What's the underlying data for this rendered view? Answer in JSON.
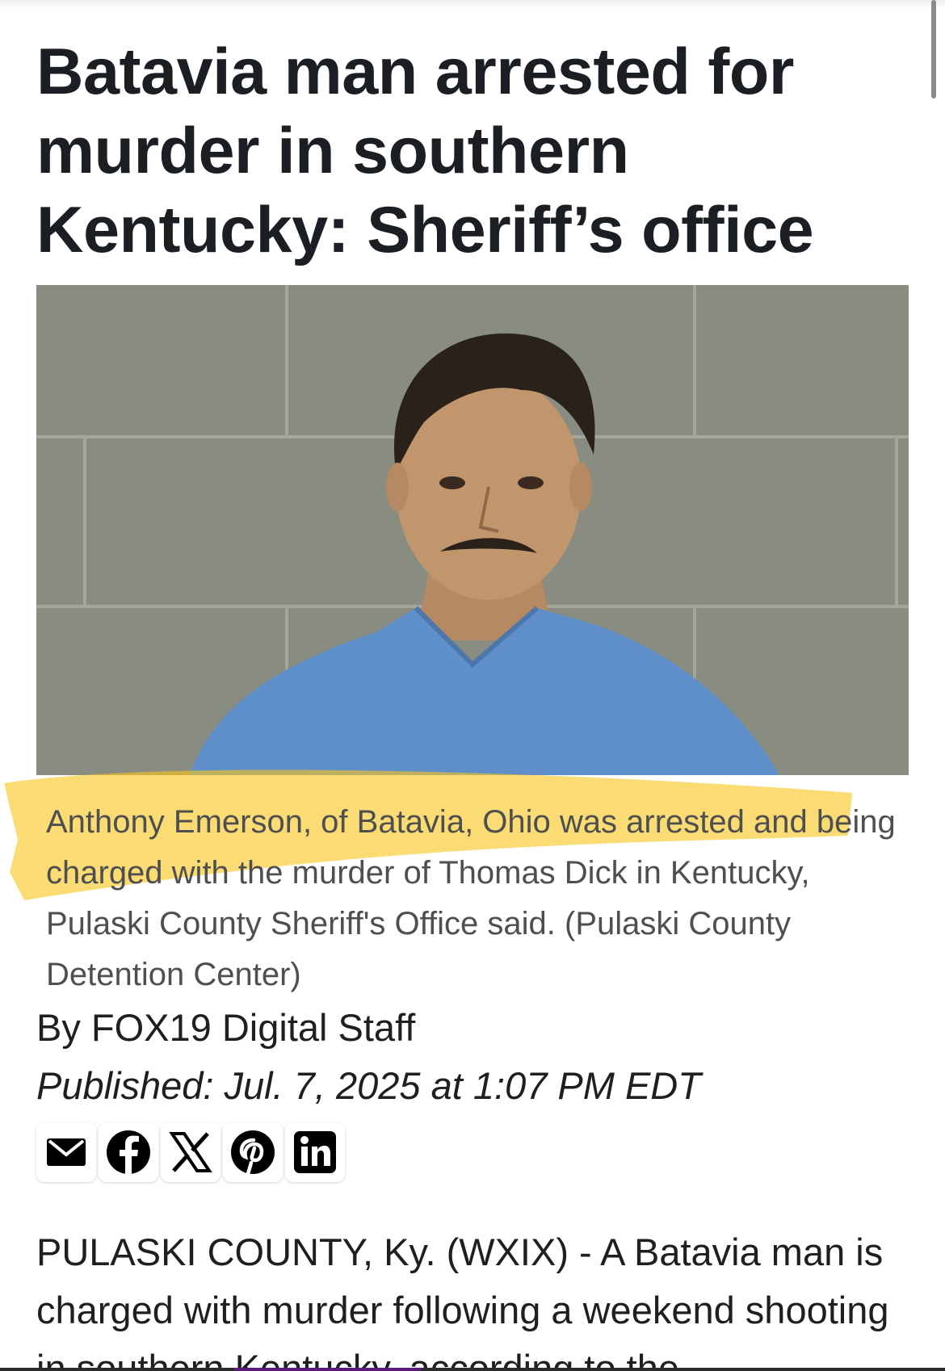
{
  "article": {
    "headline": "Batavia man arrested for murder in southern Kentucky: Sheriff’s office",
    "photo": {
      "description_icon": "mugshot-photo"
    },
    "caption": "Anthony Emerson, of Batavia, Ohio was arrested and being charged with the murder of Thomas Dick in Kentucky, Pulaski County Sheriff's Office said.  (Pulaski County Detention Center)",
    "byline": "By FOX19 Digital Staff",
    "published": "Published: Jul. 7, 2025 at 1:07 PM EDT",
    "body": "PULASKI COUNTY, Ky. (WXIX) - A Batavia man is charged with murder following a weekend shooting in southern Kentucky, according to the"
  },
  "share": {
    "buttons": [
      {
        "icon": "email-icon"
      },
      {
        "icon": "facebook-icon"
      },
      {
        "icon": "x-icon"
      },
      {
        "icon": "pinterest-icon"
      },
      {
        "icon": "linkedin-icon"
      }
    ]
  },
  "colors": {
    "highlight": "#f7c51e",
    "headline": "#1b1e22",
    "caption": "#4f4f4f",
    "shirt": "#5f8fc8",
    "wall": "#8b8e82"
  }
}
